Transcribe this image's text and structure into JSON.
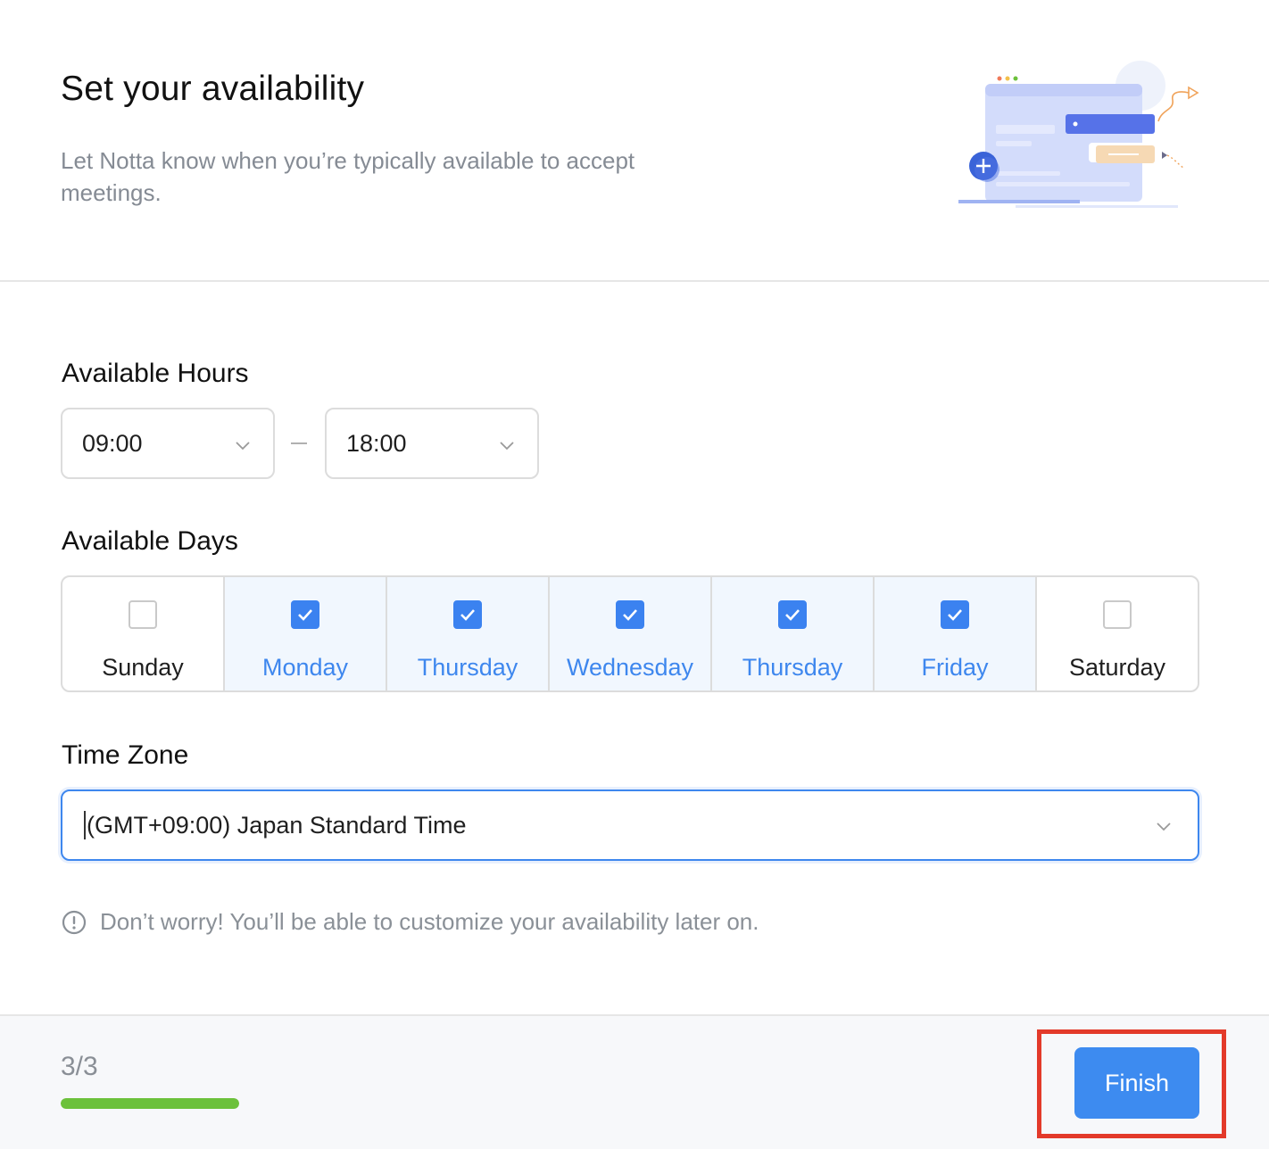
{
  "header": {
    "title": "Set your availability",
    "subtitle": "Let Notta know when you’re typically available to accept meetings."
  },
  "hours": {
    "label": "Available Hours",
    "start": "09:00",
    "end": "18:00"
  },
  "days": {
    "label": "Available Days",
    "items": [
      {
        "label": "Sunday",
        "checked": false
      },
      {
        "label": "Monday",
        "checked": true
      },
      {
        "label": "Thursday",
        "checked": true
      },
      {
        "label": "Wednesday",
        "checked": true
      },
      {
        "label": "Thursday",
        "checked": true
      },
      {
        "label": "Friday",
        "checked": true
      },
      {
        "label": "Saturday",
        "checked": false
      }
    ]
  },
  "timezone": {
    "label": "Time Zone",
    "value": "(GMT+09:00) Japan Standard Time"
  },
  "note": "Don’t worry! You’ll be able to customize your availability later on.",
  "footer": {
    "step": "3/3",
    "progress": 1.0,
    "finish_label": "Finish"
  },
  "colors": {
    "accent": "#3d8bf0",
    "progress": "#6cc13b",
    "highlight": "#e33a2a"
  }
}
